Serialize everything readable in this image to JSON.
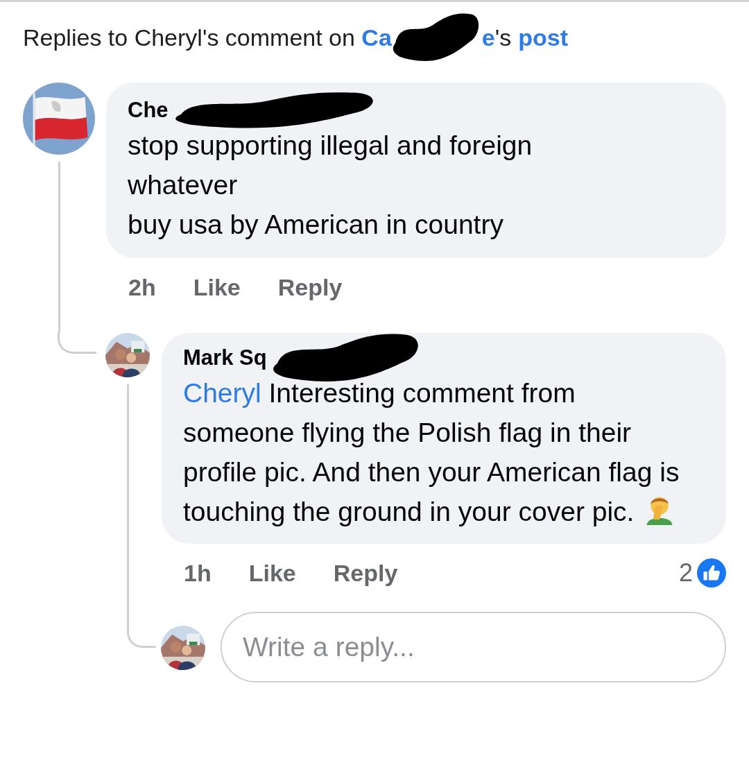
{
  "header": {
    "prefix": "Replies to Cheryl's comment on ",
    "post_author_start": "Ca",
    "post_author_end": "e",
    "possessive": "'s",
    "link": "post"
  },
  "comment": {
    "author": "Che",
    "lines": [
      "stop supporting illegal and foreign",
      "whatever",
      "buy usa by American in country"
    ],
    "time": "2h",
    "actions": [
      "Like",
      "Reply"
    ]
  },
  "reply": {
    "author": "Mark Sq",
    "mention": "Cheryl",
    "text": " Interesting comment from someone flying the Polish flag in their profile pic. And then your American flag is touching the ground in your cover pic.",
    "time": "1h",
    "actions": [
      "Like",
      "Reply"
    ],
    "reaction_count": "2"
  },
  "composer": {
    "placeholder": "Write a reply..."
  }
}
